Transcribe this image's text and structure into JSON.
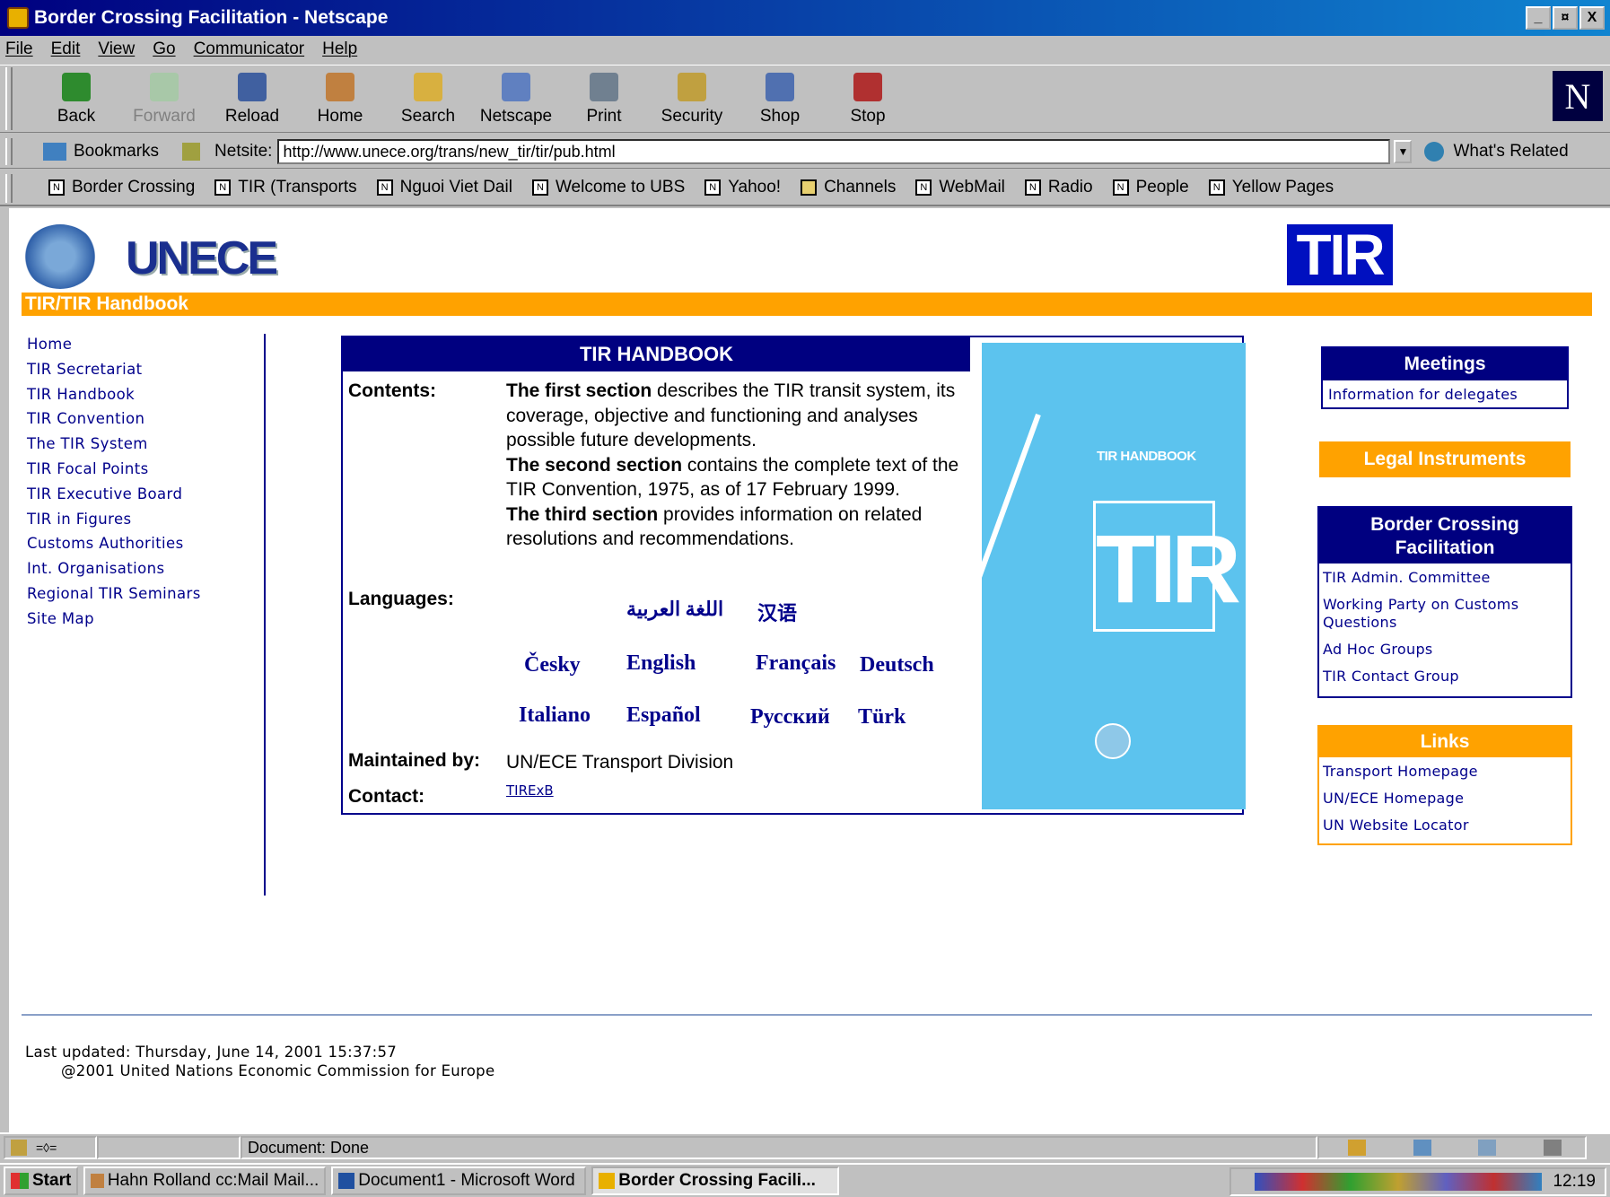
{
  "window": {
    "title": "Border Crossing Facilitation - Netscape",
    "min": "_",
    "max": "¤",
    "close": "X"
  },
  "menu": [
    "File",
    "Edit",
    "View",
    "Go",
    "Communicator",
    "Help"
  ],
  "toolbar": {
    "back": "Back",
    "forward": "Forward",
    "reload": "Reload",
    "home": "Home",
    "search": "Search",
    "netscape": "Netscape",
    "print": "Print",
    "security": "Security",
    "shop": "Shop",
    "stop": "Stop"
  },
  "location": {
    "bookmarks": "Bookmarks",
    "netsite_label": "Netsite:",
    "url": "http://www.unece.org/trans/new_tir/tir/pub.html",
    "whats_related": "What's Related"
  },
  "personal_bar": [
    "Border Crossing",
    "TIR (Transports",
    "Nguoi Viet Dail",
    "Welcome to UBS",
    "Yahoo!",
    "Channels",
    "WebMail",
    "Radio",
    "People",
    "Yellow Pages"
  ],
  "page": {
    "org": "UNECE",
    "tir_logo": "TIR",
    "section_bar": "TIR/TIR Handbook",
    "left_nav": [
      "Home",
      "TIR Secretariat",
      "TIR Handbook",
      "TIR Convention",
      "The TIR System",
      "TIR Focal Points",
      "TIR Executive Board",
      "TIR in Figures",
      "Customs Authorities",
      "Int. Organisations",
      "Regional TIR Seminars",
      "Site Map"
    ],
    "handbook": {
      "title": "TIR HANDBOOK",
      "contents_label": "Contents:",
      "s1_bold": "The first section",
      "s1_text": " describes the TIR transit system, its coverage, objective and functioning and analyses possible future developments.",
      "s2_bold": "The second section",
      "s2_text": " contains the complete text of the TIR Convention, 1975, as of 17 February 1999.",
      "s3_bold": "The third section",
      "s3_text": " provides information on related resolutions and recommendations.",
      "languages_label": "Languages:",
      "lang_arabic": "اللغة العربية",
      "lang_chinese": "汉语",
      "languages": [
        "Česky",
        "English",
        "Français",
        "Deutsch",
        "Italiano",
        "Español",
        "Русский",
        "Türk"
      ],
      "maintained_label": "Maintained by:",
      "maintained_value": "UN/ECE Transport Division",
      "contact_label": "Contact:",
      "contact_value": "TIRExB",
      "cover_title": "TIR HANDBOOK",
      "cover_logo": "TIR"
    },
    "meetings": {
      "title": "Meetings",
      "links": [
        "Information for delegates"
      ]
    },
    "legal": {
      "title": "Legal Instruments"
    },
    "border": {
      "title": "Border Crossing Facilitation",
      "links": [
        "TIR Admin. Committee",
        "Working Party on Customs Questions",
        "Ad Hoc Groups",
        "TIR Contact Group"
      ]
    },
    "links": {
      "title": "Links",
      "links": [
        "Transport Homepage",
        "UN/ECE Homepage",
        "UN Website Locator"
      ]
    },
    "footer": {
      "updated": "Last updated: Thursday, June 14, 2001 15:37:57",
      "copyright": "@2001 United Nations Economic Commission for Europe"
    }
  },
  "status": {
    "text": "Document: Done"
  },
  "taskbar": {
    "start": "Start",
    "tasks": [
      "Hahn Rolland cc:Mail Mail...",
      "Document1 - Microsoft Word",
      "Border Crossing Facili..."
    ],
    "clock": "12:19"
  },
  "colors": {
    "navy": "#000080",
    "orange": "#ffa200",
    "link": "#00008b",
    "cover": "#5cc3ee"
  }
}
